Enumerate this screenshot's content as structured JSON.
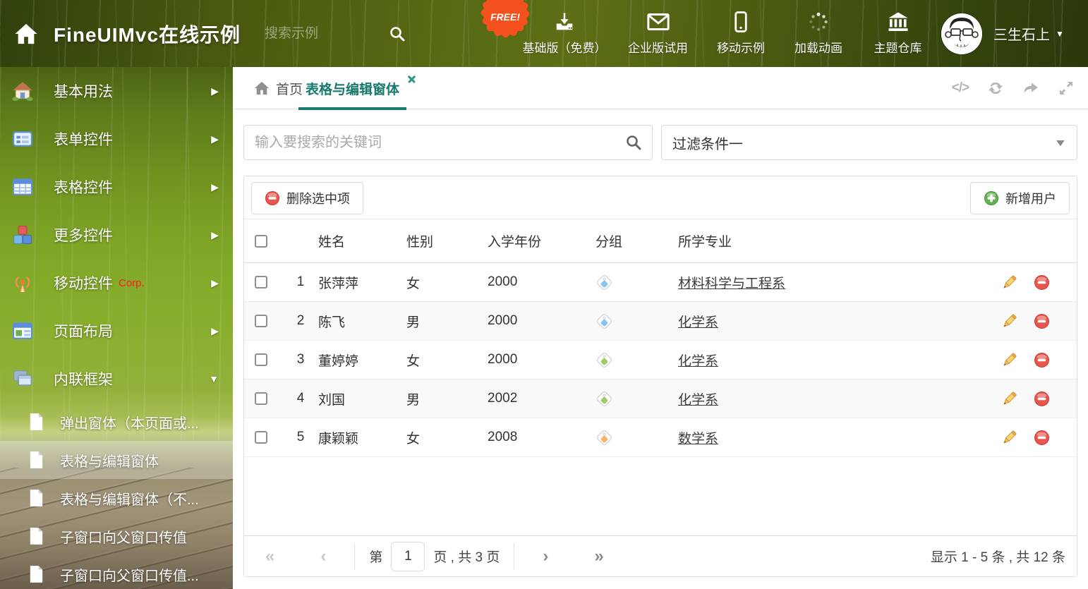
{
  "colors": {
    "accent_teal": "#17796b",
    "header_green": "#556712",
    "free_badge_orange": "#f4511e",
    "delete_red": "#e8564e",
    "add_green": "#62b152",
    "pencil_yellow": "#f6d374",
    "tag_blue": "#85c5f2",
    "tag_green": "#9ccc65",
    "tag_orange": "#f8b26a"
  },
  "header": {
    "title": "FineUIMvc在线示例",
    "search_placeholder": "搜索示例",
    "free_badge": "FREE!",
    "nav_items": [
      {
        "label": "基础版（免费）",
        "icon": "download-icon"
      },
      {
        "label": "企业版试用",
        "icon": "envelope-icon"
      },
      {
        "label": "移动示例",
        "icon": "mobile-icon"
      },
      {
        "label": "加载动画",
        "icon": "spinner-icon"
      },
      {
        "label": "主题仓库",
        "icon": "bank-icon"
      }
    ],
    "user": {
      "name": "三生石上",
      "caret": "▼"
    }
  },
  "sidebar": {
    "items": [
      {
        "label": "基本用法",
        "icon": "home-icon",
        "arrow": "▶"
      },
      {
        "label": "表单控件",
        "icon": "form-icon",
        "arrow": "▶"
      },
      {
        "label": "表格控件",
        "icon": "table-icon",
        "arrow": "▶"
      },
      {
        "label": "更多控件",
        "icon": "cubes-icon",
        "arrow": "▶"
      },
      {
        "label": "移动控件",
        "badge": "Corp.",
        "icon": "antenna-icon",
        "arrow": "▶"
      },
      {
        "label": "页面布局",
        "icon": "layout-icon",
        "arrow": "▶"
      },
      {
        "label": "内联框架",
        "icon": "frames-icon",
        "arrow": "▼",
        "expanded": true
      }
    ],
    "subitems": [
      {
        "label": "弹出窗体（本页面或..."
      },
      {
        "label": "表格与编辑窗体",
        "selected": true
      },
      {
        "label": "表格与编辑窗体（不..."
      },
      {
        "label": "子窗口向父窗口传值"
      },
      {
        "label": "子窗口向父窗口传值..."
      }
    ]
  },
  "tabs": {
    "home": {
      "label": "首页",
      "icon": "home-icon"
    },
    "active": {
      "label": "表格与编辑窗体",
      "closable": true
    }
  },
  "toolbar_icons": [
    "code-icon",
    "refresh-icon",
    "forward-icon",
    "expand-icon"
  ],
  "toolbar": {
    "code_glyph": "</>"
  },
  "filters": {
    "search_placeholder": "输入要搜索的关键词",
    "filter_value": "过滤条件一"
  },
  "grid": {
    "delete_button": "删除选中项",
    "add_button": "新增用户",
    "columns": {
      "name": "姓名",
      "gender": "性别",
      "year": "入学年份",
      "group": "分组",
      "major": "所学专业"
    },
    "rows": [
      {
        "num": "1",
        "name": "张萍萍",
        "gender": "女",
        "year": "2000",
        "tag_color": "#85c5f2",
        "major": "材料科学与工程系"
      },
      {
        "num": "2",
        "name": "陈飞",
        "gender": "男",
        "year": "2000",
        "tag_color": "#85c5f2",
        "major": "化学系"
      },
      {
        "num": "3",
        "name": "董婷婷",
        "gender": "女",
        "year": "2000",
        "tag_color": "#9ccc65",
        "major": "化学系"
      },
      {
        "num": "4",
        "name": "刘国",
        "gender": "男",
        "year": "2002",
        "tag_color": "#9ccc65",
        "major": "化学系"
      },
      {
        "num": "5",
        "name": "康颖颖",
        "gender": "女",
        "year": "2008",
        "tag_color": "#f8b26a",
        "major": "数学系"
      }
    ],
    "pagination": {
      "first": "«",
      "prev": "‹",
      "next": "›",
      "last": "»",
      "page_prefix": "第",
      "current_page": "1",
      "page_suffix": "页 , 共 3 页",
      "summary": "显示 1 - 5 条 , 共 12 条"
    }
  }
}
